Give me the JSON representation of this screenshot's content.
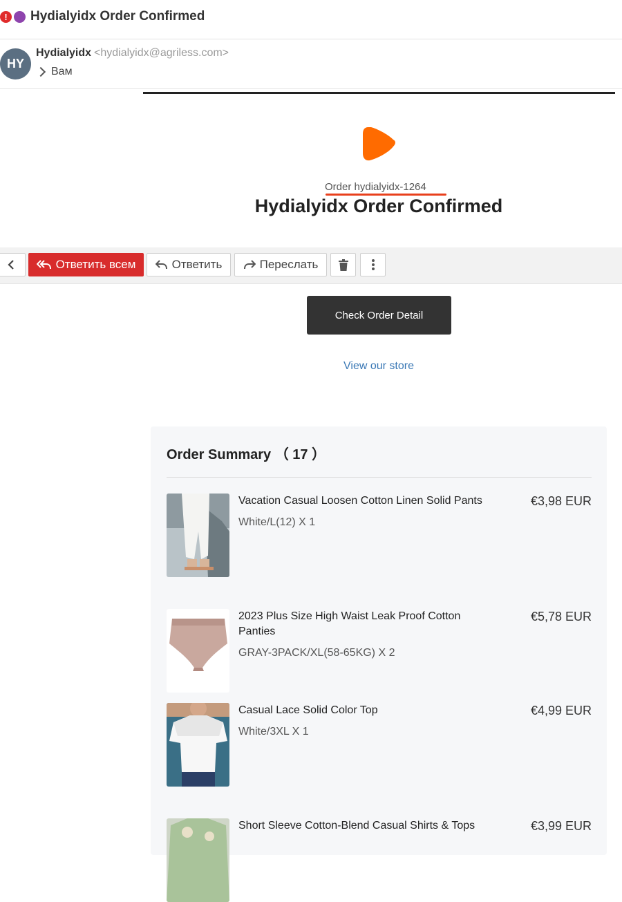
{
  "email": {
    "subject": "Hydialyidx Order Confirmed",
    "priority_badge": "!",
    "sender": {
      "initials": "HY",
      "name": "Hydialyidx",
      "email": "<hydialyidx@agriless.com>",
      "recipient": "Вам"
    }
  },
  "toolbar": {
    "reply_all_label": "Ответить всем",
    "reply_label": "Ответить",
    "forward_label": "Переслать"
  },
  "body": {
    "order_number": "Order hydialyidx-1264",
    "title": "Hydialyidx Order Confirmed",
    "cta_label": "Check Order Detail",
    "store_link": "View our store",
    "accent_color": "#ff6b00"
  },
  "summary": {
    "title": "Order Summary （ 17 ）",
    "items": [
      {
        "name": "Vacation Casual Loosen Cotton Linen Solid Pants",
        "variant": "White/L(12) X 1",
        "price": "€3,98 EUR"
      },
      {
        "name": "2023 Plus Size High Waist Leak Proof Cotton Panties",
        "variant": "GRAY-3PACK/XL(58-65KG) X 2",
        "price": "€5,78 EUR"
      },
      {
        "name": "Casual Lace Solid Color Top",
        "variant": "White/3XL X 1",
        "price": "€4,99 EUR"
      },
      {
        "name": "Short Sleeve Cotton-Blend Casual Shirts & Tops",
        "variant": "",
        "price": "€3,99 EUR"
      }
    ]
  }
}
